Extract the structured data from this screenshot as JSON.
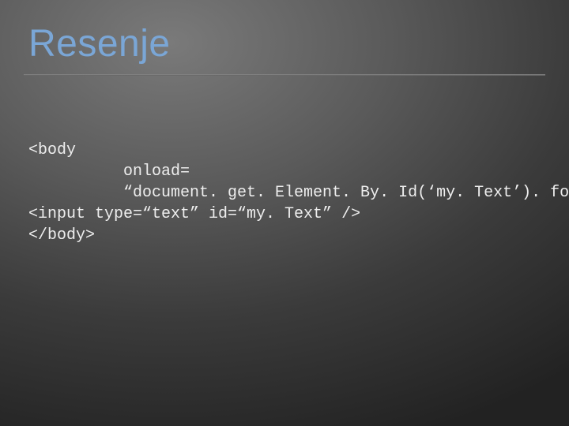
{
  "slide": {
    "title": "Resenje",
    "code": {
      "line1": "<body",
      "line2": "     onload=",
      "line3": "     “document. get. Element. By. Id(‘my. Text’). focus(); ”>",
      "line4": "<input type=“text” id=“my. Text” />",
      "line5": "</body>"
    }
  }
}
